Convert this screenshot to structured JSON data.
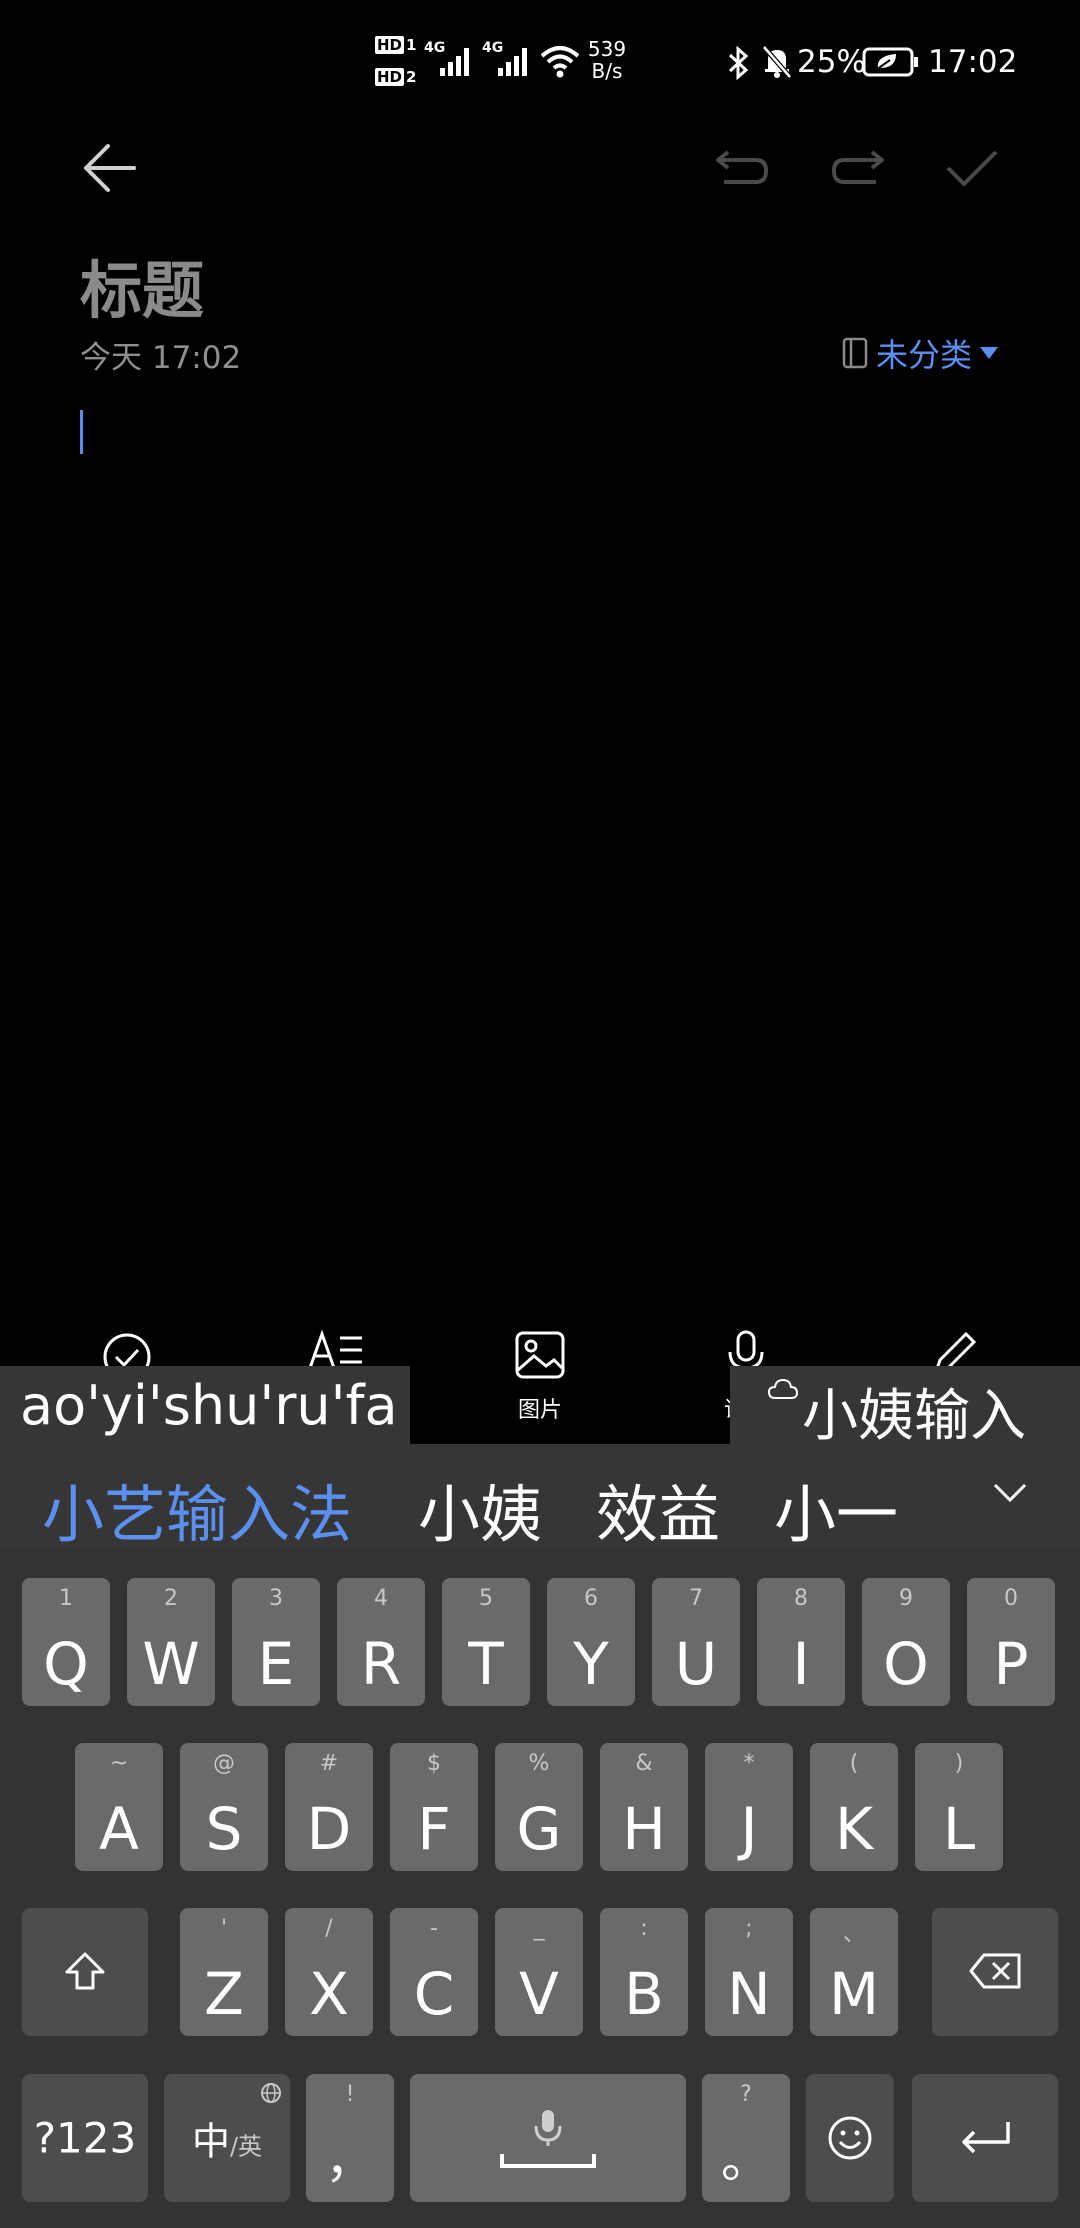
{
  "status": {
    "hd1": "HD",
    "hd1_sub": "1",
    "hd2": "HD",
    "hd2_sub": "2",
    "net1": "4G",
    "net2": "4G",
    "speed_value": "539",
    "speed_unit": "B/s",
    "battery": "25%",
    "time": "17:02"
  },
  "editor": {
    "title_placeholder": "标题",
    "date": "今天 17:02",
    "category": "未分类"
  },
  "toolbar": {
    "image_label": "图片",
    "voice_label": "语音"
  },
  "ime": {
    "composition": "ao'yi'shu'ru'fa",
    "cloud_suggestion": "小姨输入",
    "candidates": [
      "小艺输入法",
      "小姨",
      "效益",
      "小一"
    ]
  },
  "keyboard": {
    "row1": [
      {
        "k": "Q",
        "s": "1"
      },
      {
        "k": "W",
        "s": "2"
      },
      {
        "k": "E",
        "s": "3"
      },
      {
        "k": "R",
        "s": "4"
      },
      {
        "k": "T",
        "s": "5"
      },
      {
        "k": "Y",
        "s": "6"
      },
      {
        "k": "U",
        "s": "7"
      },
      {
        "k": "I",
        "s": "8"
      },
      {
        "k": "O",
        "s": "9"
      },
      {
        "k": "P",
        "s": "0"
      }
    ],
    "row2": [
      {
        "k": "A",
        "s": "~"
      },
      {
        "k": "S",
        "s": "@"
      },
      {
        "k": "D",
        "s": "#"
      },
      {
        "k": "F",
        "s": "$"
      },
      {
        "k": "G",
        "s": "%"
      },
      {
        "k": "H",
        "s": "&"
      },
      {
        "k": "J",
        "s": "*"
      },
      {
        "k": "K",
        "s": "("
      },
      {
        "k": "L",
        "s": ")"
      }
    ],
    "row3": [
      {
        "k": "Z",
        "s": "'"
      },
      {
        "k": "X",
        "s": "/"
      },
      {
        "k": "C",
        "s": "-"
      },
      {
        "k": "V",
        "s": "_"
      },
      {
        "k": "B",
        "s": ":"
      },
      {
        "k": "N",
        "s": ";"
      },
      {
        "k": "M",
        "s": "、"
      }
    ],
    "num_key": "?123",
    "lang_main": "中",
    "lang_sub": "/英",
    "comma_main": "，",
    "comma_sub": "!",
    "period_main": "。",
    "period_sub": "?"
  }
}
